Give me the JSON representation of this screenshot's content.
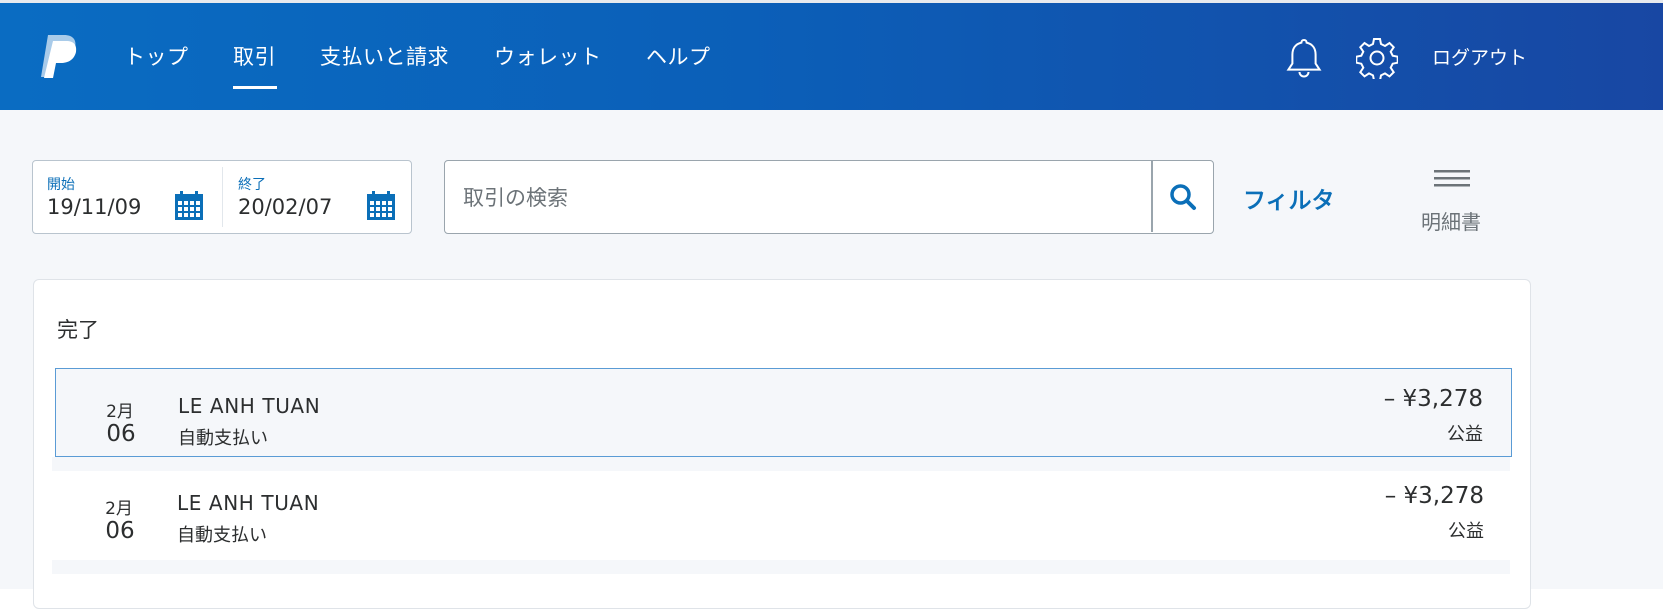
{
  "header": {
    "logo_icon": "paypal-logo",
    "nav": [
      {
        "label": "トップ"
      },
      {
        "label": "取引",
        "active": true
      },
      {
        "label": "支払いと請求"
      },
      {
        "label": "ウォレット"
      },
      {
        "label": "ヘルプ"
      }
    ],
    "notifications_icon": "bell-icon",
    "settings_icon": "gear-icon",
    "logout_label": "ログアウト"
  },
  "filters": {
    "start_label": "開始",
    "start_value": "19/11/09",
    "end_label": "終了",
    "end_value": "20/02/07",
    "calendar_icon": "calendar-icon",
    "search_placeholder": "取引の検索",
    "search_value": "",
    "search_icon": "search-icon",
    "filter_label": "フィルタ",
    "statement_icon": "menu-lines-icon",
    "statement_label": "明細書"
  },
  "transactions": {
    "section_title": "完了",
    "items": [
      {
        "month": "2月",
        "day": "06",
        "name": "LE ANH TUAN",
        "type": "自動支払い",
        "amount": "– ¥3,278",
        "category": "公益",
        "selected": true
      },
      {
        "month": "2月",
        "day": "06",
        "name": "LE ANH TUAN",
        "type": "自動支払い",
        "amount": "– ¥3,278",
        "category": "公益",
        "selected": false
      }
    ]
  },
  "colors": {
    "header_start": "#0a6cc2",
    "header_end": "#1847a3",
    "accent": "#0b6fb8",
    "selected_border": "#5a9bd5",
    "page_background": "#f5f7fa"
  }
}
